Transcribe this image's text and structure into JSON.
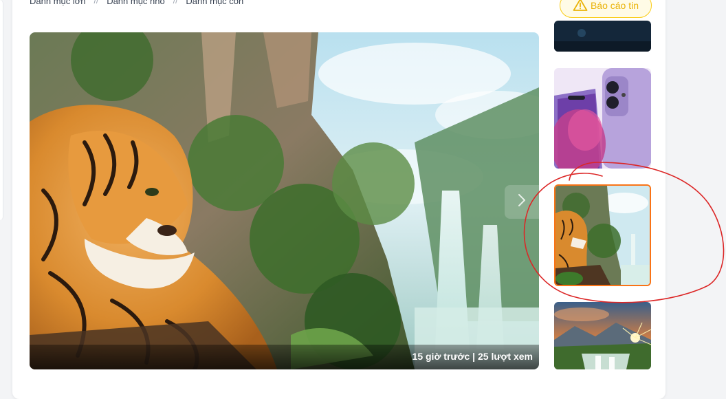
{
  "breadcrumb": {
    "items": [
      "Danh mục lớn",
      "Danh mục nhỏ",
      "Danh mục con"
    ],
    "separator": "//"
  },
  "report_button": {
    "label": "Báo cáo tin",
    "icon": "warning-triangle-icon",
    "color": "#eab308"
  },
  "main_image": {
    "icon": "tiger-waterfall-artwork",
    "caption": "15 giờ trước | 25 lượt xem"
  },
  "thumbnails": [
    {
      "icon": "dark-night-scene"
    },
    {
      "icon": "purple-iphone"
    },
    {
      "icon": "tiger-waterfall-artwork",
      "selected": true
    },
    {
      "icon": "sunset-mountain-waterfall"
    }
  ],
  "colors": {
    "active_border": "#f97316",
    "annotation": "#dc2626"
  }
}
